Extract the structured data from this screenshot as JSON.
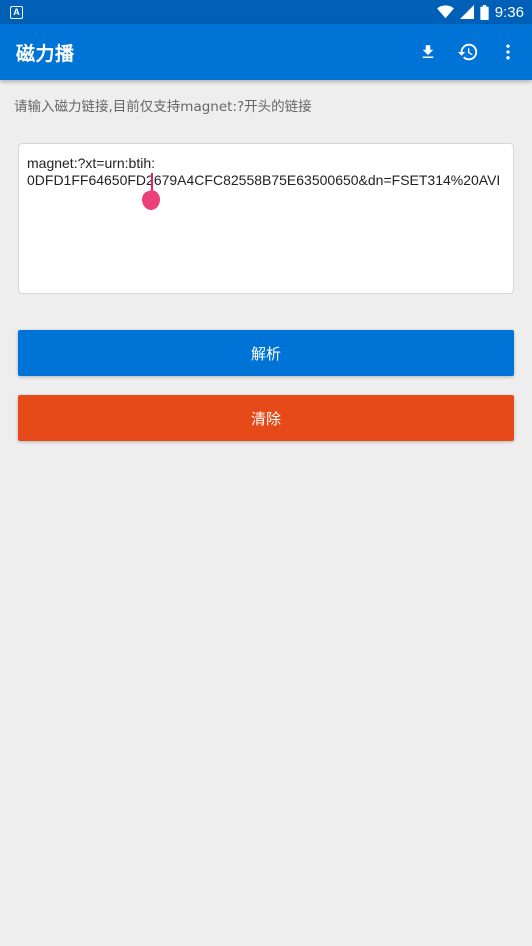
{
  "status_bar": {
    "notification_icon": "A",
    "time": "9:36",
    "icons": [
      "wifi-icon",
      "signal-icon",
      "battery-icon"
    ]
  },
  "app_bar": {
    "title": "磁力播",
    "actions": [
      "download-icon",
      "history-icon",
      "more-vert-icon"
    ],
    "color": "#0074d6"
  },
  "hint": "请输入磁力链接,目前仅支持magnet:?开头的链接",
  "magnet_input": {
    "value": "magnet:?xt=urn:btih:\n0DFD1FF64650FD2679A4CFC82558B75E63500650&dn=FSET314%20AVI"
  },
  "buttons": {
    "parse_label": "解析",
    "parse_color": "#0074d6",
    "clear_label": "清除",
    "clear_color": "#e64a19"
  }
}
